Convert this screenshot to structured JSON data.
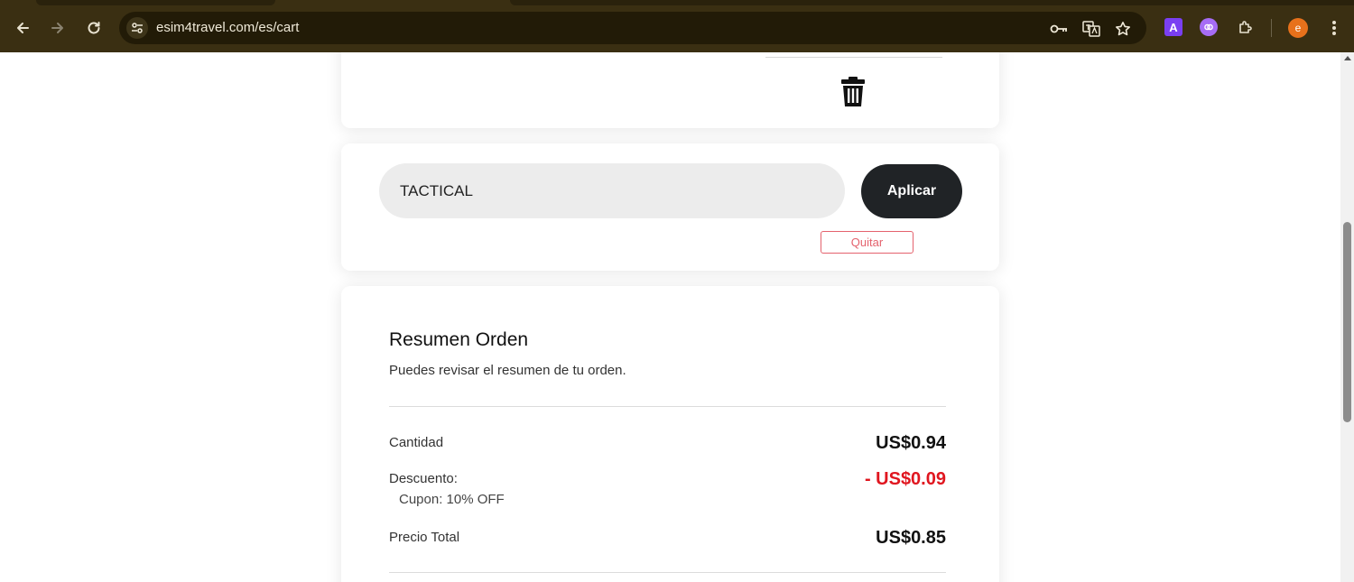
{
  "browser": {
    "url": "esim4travel.com/es/cart",
    "profile_initial": "e",
    "extension_a_label": "A"
  },
  "coupon": {
    "code_value": "TACTICAL",
    "apply_label": "Aplicar",
    "remove_label": "Quitar"
  },
  "summary": {
    "title": "Resumen Orden",
    "subtitle": "Puedes revisar el resumen de tu orden.",
    "quantity_label": "Cantidad",
    "quantity_value": "US$0.94",
    "discount_label": "Descuento:",
    "discount_value": "- US$0.09",
    "coupon_note": "Cupon: 10% OFF",
    "total_label": "Precio Total",
    "total_value": "US$0.85"
  },
  "colors": {
    "chrome_bg": "#3a2f12",
    "apply_button": "#202326",
    "discount_red": "#e0161f",
    "remove_border": "#e4626d"
  }
}
